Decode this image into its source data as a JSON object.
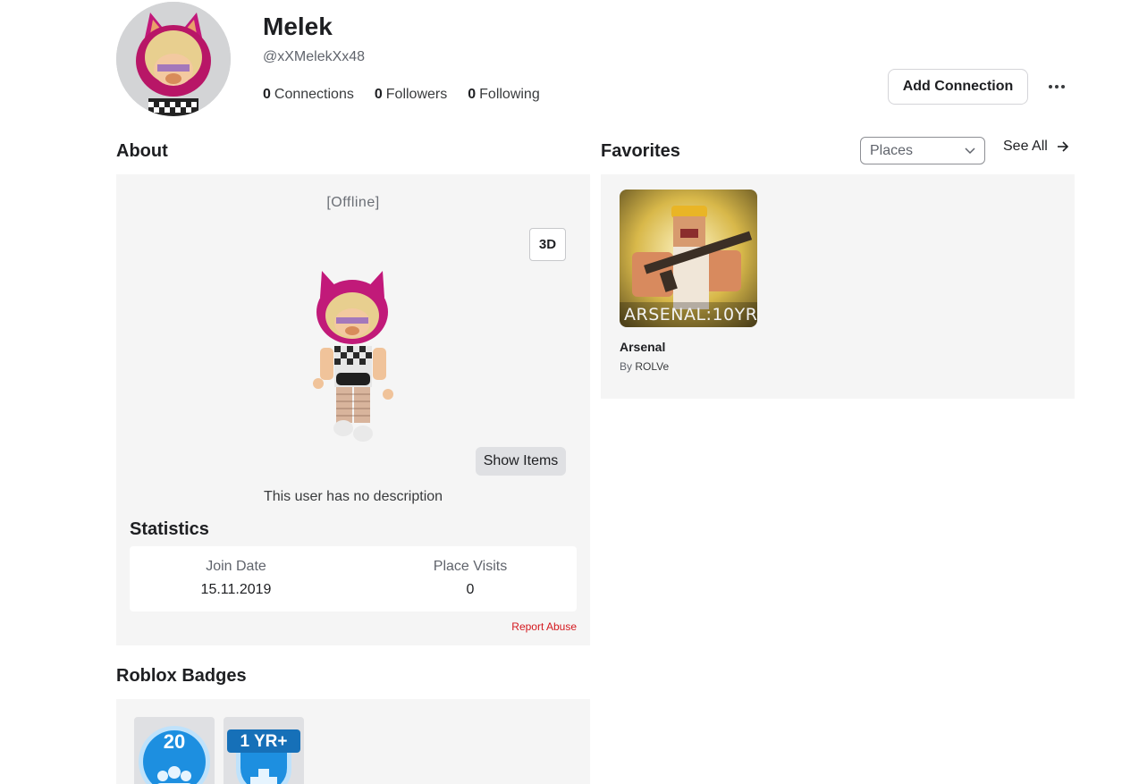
{
  "profile": {
    "display_name": "Melek",
    "username": "@xXMelekXx48",
    "connections_count": "0",
    "connections_label": "Connections",
    "followers_count": "0",
    "followers_label": "Followers",
    "following_count": "0",
    "following_label": "Following",
    "add_connection_label": "Add Connection",
    "more_icon": "ellipsis-icon"
  },
  "about": {
    "title": "About",
    "presence": "[Offline]",
    "btn_3d": "3D",
    "show_items": "Show Items",
    "description": "This user has no description"
  },
  "statistics": {
    "title": "Statistics",
    "join_date_label": "Join Date",
    "join_date_value": "15.11.2019",
    "place_visits_label": "Place Visits",
    "place_visits_value": "0",
    "report_abuse": "Report Abuse"
  },
  "favorites": {
    "title": "Favorites",
    "filter_selected": "Places",
    "see_all": "See All",
    "items": [
      {
        "name": "Arsenal",
        "by_label": "By",
        "creator": "ROLVe",
        "thumb_text": "ARSENAL:10YR"
      }
    ]
  },
  "badges": {
    "title": "Roblox Badges",
    "items": [
      {
        "name": "friendship-badge",
        "text": "20"
      },
      {
        "name": "veteran-badge",
        "text": "1 YR+"
      }
    ]
  },
  "colors": {
    "panel_bg": "#f5f5f5",
    "report_red": "#d4181e",
    "badge_blue": "#1d8fe0"
  }
}
